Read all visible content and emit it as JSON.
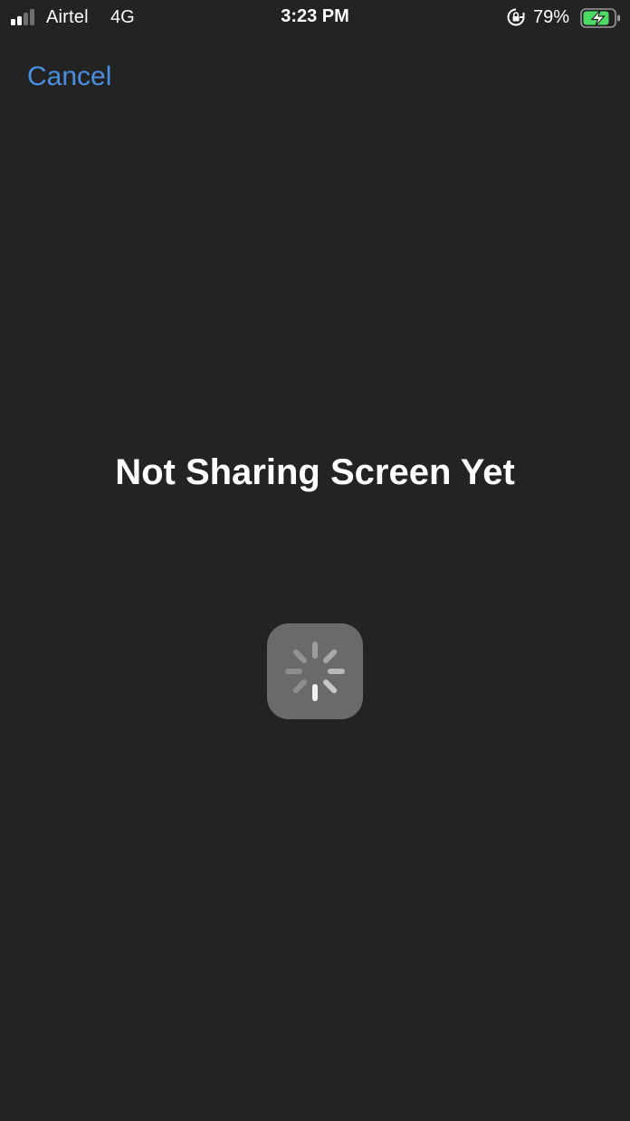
{
  "status_bar": {
    "carrier": "Airtel",
    "network": "4G",
    "time": "3:23 PM",
    "battery_percent": "79%",
    "signal_strength_bars": 2,
    "signal_max_bars": 4,
    "icons": [
      "signal-icon",
      "orientation-lock-icon",
      "battery-charging-icon"
    ]
  },
  "nav": {
    "cancel_label": "Cancel"
  },
  "main": {
    "title": "Not Sharing Screen Yet",
    "loading_indicator": "spinner-icon"
  },
  "colors": {
    "background": "#232323",
    "accent": "#4a8fdf",
    "battery_green": "#4cd964",
    "spinner_box": "#6a6a6a"
  }
}
